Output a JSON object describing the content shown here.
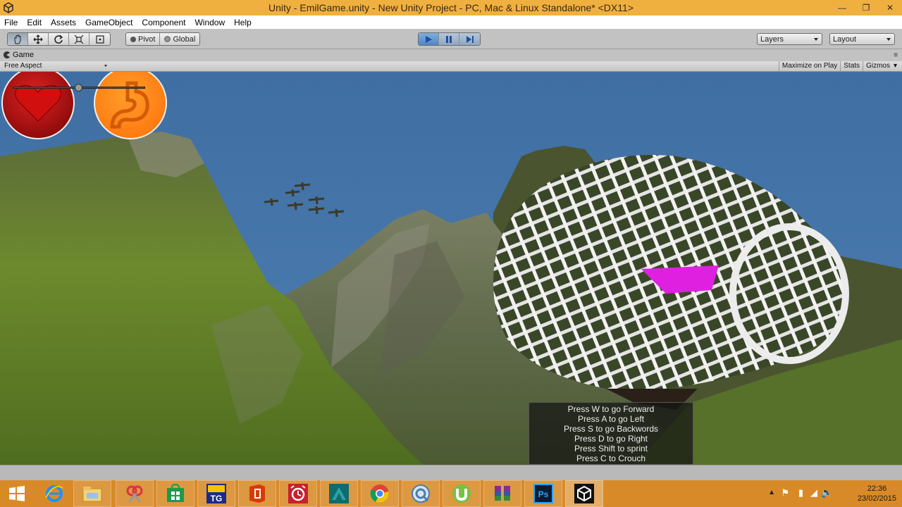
{
  "window": {
    "title": "Unity - EmilGame.unity - New Unity Project - PC, Mac & Linux Standalone* <DX11>",
    "minimize_icon": "minimize-icon",
    "restore_icon": "restore-icon",
    "close_icon": "close-icon"
  },
  "menu": [
    "File",
    "Edit",
    "Assets",
    "GameObject",
    "Component",
    "Window",
    "Help"
  ],
  "toolbar": {
    "pivot_label": "Pivot",
    "global_label": "Global",
    "layers_label": "Layers",
    "layout_label": "Layout"
  },
  "game_panel": {
    "tab_label": "Game",
    "aspect_label": "Free Aspect",
    "maximize_label": "Maximize on Play",
    "stats_label": "Stats",
    "gizmos_label": "Gizmos"
  },
  "hud": {
    "health_icon": "heart-icon",
    "hunger_icon": "stomach-icon",
    "slider_value": 0.5,
    "colors": {
      "health": "#c01818",
      "hunger": "#ff8a1a",
      "highlight": "#e020e0"
    }
  },
  "instructions": [
    "Press W to go Forward",
    "Press A to go Left",
    "Press S to go Backwords",
    "Press D to go Right",
    "Press Shift to sprint",
    "Press C to Crouch"
  ],
  "taskbar": {
    "apps": [
      "windows-start-icon",
      "internet-explorer-icon",
      "file-explorer-icon",
      "snipping-tool-icon",
      "store-icon",
      "tg-app-icon",
      "office-icon",
      "alarm-icon",
      "3dsmax-icon",
      "chrome-icon",
      "quicktime-icon",
      "utorrent-icon",
      "winrar-icon",
      "photoshop-icon",
      "unity-icon"
    ],
    "time": "22:36",
    "date": "23/02/2015"
  }
}
